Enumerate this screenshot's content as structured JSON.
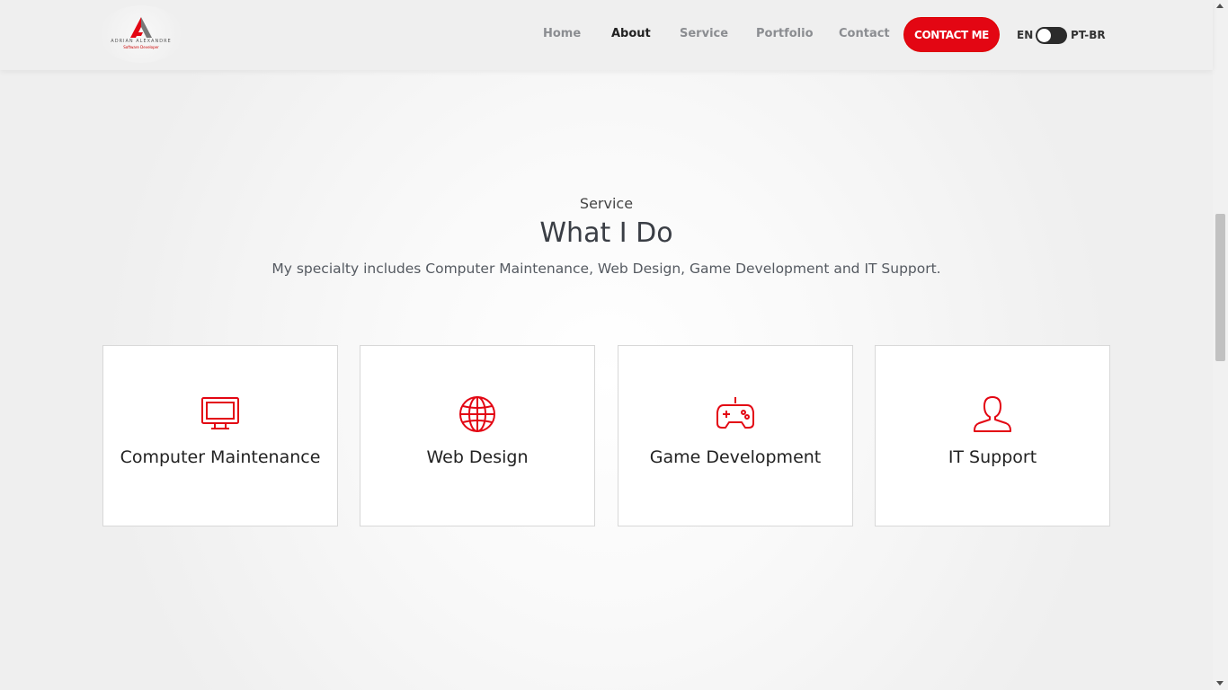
{
  "header": {
    "logo": {
      "name": "ADRIAN ALEXANDRE",
      "tagline": "Software Developer",
      "mark": "logo-mark"
    },
    "nav": [
      {
        "label": "Home",
        "active": false
      },
      {
        "label": "About",
        "active": true
      },
      {
        "label": "Service",
        "active": false
      },
      {
        "label": "Portfolio",
        "active": false
      },
      {
        "label": "Contact",
        "active": false
      }
    ],
    "cta_label": "CONTACT ME",
    "lang_left": "EN",
    "lang_right": "PT-BR"
  },
  "section": {
    "eyebrow": "Service",
    "title": "What I Do",
    "subtitle": "My specialty includes Computer Maintenance, Web Design, Game Development and IT Support."
  },
  "services": [
    {
      "label": "Computer Maintenance",
      "icon": "monitor-icon"
    },
    {
      "label": "Web Design",
      "icon": "globe-icon"
    },
    {
      "label": "Game Development",
      "icon": "gamepad-icon"
    },
    {
      "label": "IT Support",
      "icon": "user-icon"
    }
  ],
  "colors": {
    "accent": "#e30613",
    "nav_text": "#8b8d91",
    "nav_active": "#222222",
    "header_bg": "#efefef"
  }
}
